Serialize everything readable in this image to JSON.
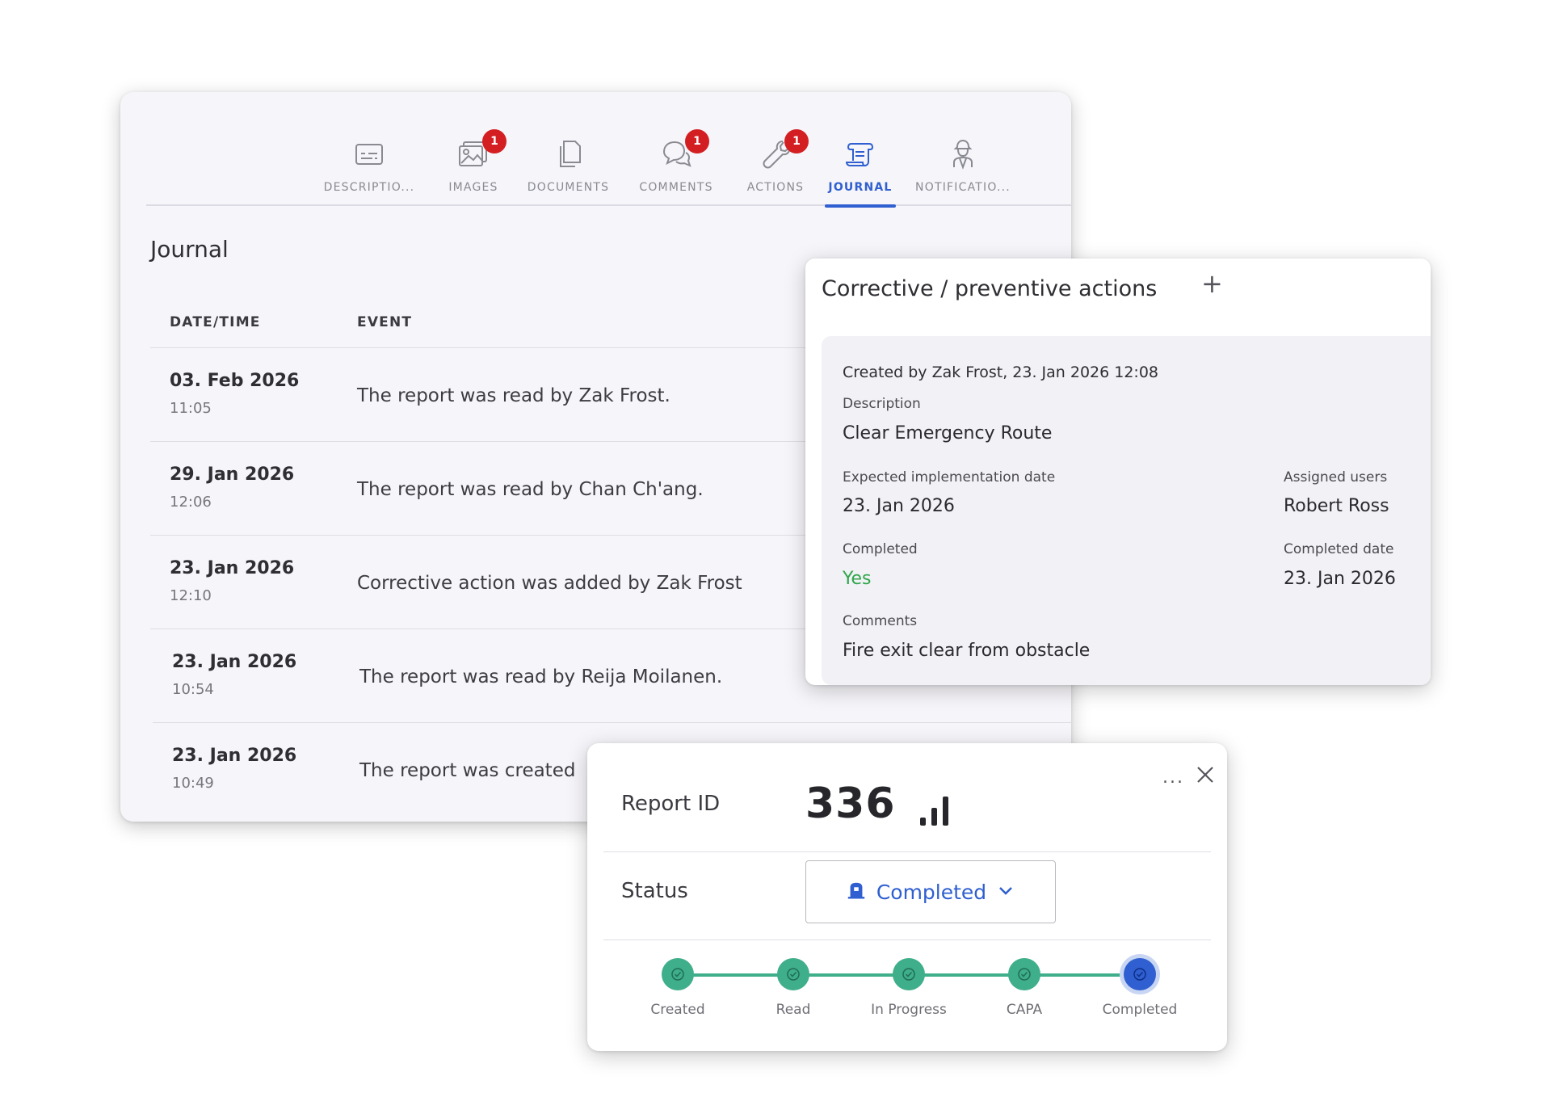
{
  "tabs": [
    {
      "label": "DESCRIPTIO...",
      "icon": "description-icon",
      "badge": ""
    },
    {
      "label": "IMAGES",
      "icon": "images-icon",
      "badge": "1"
    },
    {
      "label": "DOCUMENTS",
      "icon": "documents-icon",
      "badge": ""
    },
    {
      "label": "COMMENTS",
      "icon": "comments-icon",
      "badge": "1"
    },
    {
      "label": "ACTIONS",
      "icon": "actions-icon",
      "badge": "1"
    },
    {
      "label": "JOURNAL",
      "icon": "journal-icon",
      "badge": "",
      "active": true
    },
    {
      "label": "NOTIFICATIO...",
      "icon": "notifications-icon",
      "badge": ""
    }
  ],
  "journal": {
    "title": "Journal",
    "columns": {
      "datetime": "DATE/TIME",
      "event": "EVENT"
    },
    "rows": [
      {
        "date": "03. Feb 2026",
        "time": "11:05",
        "event": "The report was read by Zak Frost."
      },
      {
        "date": "29. Jan 2026",
        "time": "12:06",
        "event": "The report was read by Chan Ch'ang."
      },
      {
        "date": "23. Jan 2026",
        "time": "12:10",
        "event": "Corrective action was added by Zak Frost"
      },
      {
        "date": "23. Jan 2026",
        "time": "10:54",
        "event": "The report was read by Reija Moilanen."
      },
      {
        "date": "23. Jan 2026",
        "time": "10:49",
        "event": "The report was created"
      }
    ]
  },
  "capa": {
    "title": "Corrective / preventive actions",
    "add_label": "+",
    "created_by": "Created by Zak Frost, 23. Jan 2026 12:08",
    "description_label": "Description",
    "description_value": "Clear Emergency Route",
    "expected_label": "Expected implementation date",
    "expected_value": "23. Jan 2026",
    "assigned_label": "Assigned users",
    "assigned_value": "Robert Ross",
    "completed_label": "Completed",
    "completed_value": "Yes",
    "completed_date_label": "Completed date",
    "completed_date_value": "23. Jan 2026",
    "comments_label": "Comments",
    "comments_value": "Fire exit clear from obstacle"
  },
  "report": {
    "id_label": "Report ID",
    "id_value": "336",
    "menu_label": "...",
    "status_label": "Status",
    "status_value": "Completed",
    "steps": [
      "Created",
      "Read",
      "In Progress",
      "CAPA",
      "Completed"
    ],
    "current_step": 4
  },
  "colors": {
    "accent": "#2f5fd0",
    "step": "#3fae8a",
    "badge": "#d31f22",
    "yes": "#2fa64b"
  }
}
